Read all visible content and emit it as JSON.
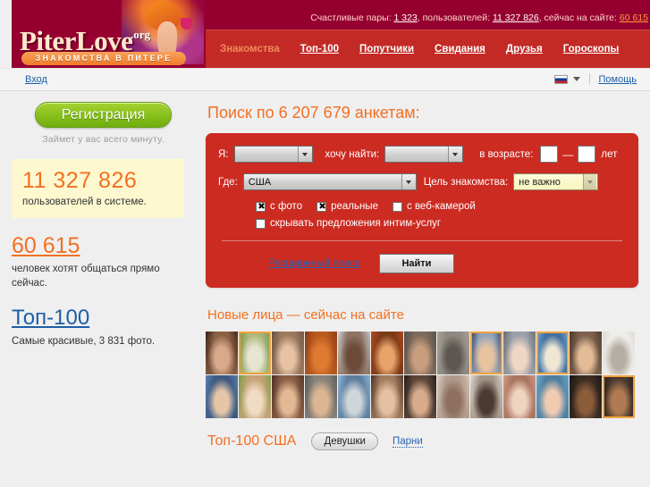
{
  "header": {
    "logo": {
      "word": "PiterLove",
      "org": ".org",
      "tagline": "ЗНАКОМСТВА В ПИТЕРЕ"
    },
    "stats": {
      "couples_label": "Счастливые пары:",
      "couples_value": "1 323",
      "users_label": ", пользователей:",
      "users_value": "11 327 826",
      "online_label": ", сейчас на сайте:",
      "online_value": "60 615"
    },
    "nav": [
      {
        "label": "Знакомства",
        "active": true
      },
      {
        "label": "Топ-100",
        "active": false
      },
      {
        "label": "Попутчики",
        "active": false
      },
      {
        "label": "Свидания",
        "active": false
      },
      {
        "label": "Друзья",
        "active": false
      },
      {
        "label": "Гороскопы",
        "active": false
      }
    ]
  },
  "loginbar": {
    "login_label": "Вход",
    "flag_icon": "russian-flag-icon",
    "caret_icon": "chevron-down-icon",
    "help_label": "Помощь"
  },
  "sidebar": {
    "register_button": "Регистрация",
    "register_sub": "Займет у вас всего минуту.",
    "users_number": "11 327 826",
    "users_caption": "пользователей в системе.",
    "online_number": "60 615",
    "online_caption": "человек хотят общаться прямо сейчас.",
    "top100_link": "Топ-100",
    "top100_caption": "Самые красивые, 3 831 фото."
  },
  "search": {
    "title": "Поиск по 6 207 679 анкетам:",
    "label_me": "Я:",
    "value_me": "",
    "label_find": "хочу найти:",
    "value_find": "",
    "label_age": "в возрасте:",
    "age_from": "",
    "age_to": "",
    "age_dash": "—",
    "age_unit": "лет",
    "label_where": "Где:",
    "value_where": "США",
    "label_goal": "Цель знакомства:",
    "value_goal": "не важно",
    "checkboxes": [
      {
        "label": "с фото",
        "checked": true
      },
      {
        "label": "реальные",
        "checked": true
      },
      {
        "label": "с веб-камерой",
        "checked": false
      },
      {
        "label": "скрывать предложения интим-услуг",
        "checked": false
      }
    ],
    "advanced_link": "Расширеный поиск",
    "find_button": "Найти"
  },
  "newfaces": {
    "title": "Новые лица — сейчас на сайте",
    "photos": [
      {
        "name": "photo-1",
        "online": false,
        "c1": "#3b2318",
        "c2": "#d8a98a",
        "c3": "#8a5f44"
      },
      {
        "name": "photo-2",
        "online": true,
        "c1": "#6f8f4a",
        "c2": "#e8e4d2",
        "c3": "#aab87a"
      },
      {
        "name": "photo-3",
        "online": false,
        "c1": "#6b5244",
        "c2": "#e7c2a4",
        "c3": "#9d7a5e"
      },
      {
        "name": "photo-4",
        "online": false,
        "c1": "#8a3a12",
        "c2": "#e07a32",
        "c3": "#b85a1e"
      },
      {
        "name": "photo-5",
        "online": false,
        "c1": "#c9cdd2",
        "c2": "#6b4a3a",
        "c3": "#8e7463"
      },
      {
        "name": "photo-6",
        "online": false,
        "c1": "#b5491c",
        "c2": "#e9a26a",
        "c3": "#7a3a18"
      },
      {
        "name": "photo-7",
        "online": false,
        "c1": "#53504c",
        "c2": "#c99d7e",
        "c3": "#7d6a5a"
      },
      {
        "name": "photo-8",
        "online": false,
        "c1": "#a9a399",
        "c2": "#5c5750",
        "c3": "#8d8880"
      },
      {
        "name": "photo-9",
        "online": true,
        "c1": "#2b3a55",
        "c2": "#e8c3a0",
        "c3": "#8fa3bb"
      },
      {
        "name": "photo-10",
        "online": false,
        "c1": "#6b6f76",
        "c2": "#f0d7c5",
        "c3": "#9aa0a8"
      },
      {
        "name": "photo-11",
        "online": true,
        "c1": "#6fa8d8",
        "c2": "#efe6d4",
        "c3": "#3e6f9e"
      },
      {
        "name": "photo-12",
        "online": false,
        "c1": "#4a3a30",
        "c2": "#e3bc97",
        "c3": "#7b5f4b"
      },
      {
        "name": "photo-13",
        "online": false,
        "c1": "#dedad4",
        "c2": "#b6aea4",
        "c3": "#efeeea"
      },
      {
        "name": "photo-14",
        "online": false,
        "c1": "#5a7fae",
        "c2": "#e6c6a8",
        "c3": "#3c5a80"
      },
      {
        "name": "photo-15",
        "online": false,
        "c1": "#7c9d46",
        "c2": "#f0dcc2",
        "c3": "#c6a277"
      },
      {
        "name": "photo-16",
        "online": false,
        "c1": "#4b2f26",
        "c2": "#e3b894",
        "c3": "#8a5d44"
      },
      {
        "name": "photo-17",
        "online": false,
        "c1": "#5b5a56",
        "c2": "#dcb692",
        "c3": "#86817a"
      },
      {
        "name": "photo-18",
        "online": false,
        "c1": "#8fb6d8",
        "c2": "#cfd6da",
        "c3": "#5d7e9c"
      },
      {
        "name": "photo-19",
        "online": false,
        "c1": "#4a3326",
        "c2": "#e6c0a2",
        "c3": "#a07b5e"
      },
      {
        "name": "photo-20",
        "online": false,
        "c1": "#241c18",
        "c2": "#d8ab8c",
        "c3": "#5c463a"
      },
      {
        "name": "photo-21",
        "online": false,
        "c1": "#d7c8bc",
        "c2": "#8f7060",
        "c3": "#b09a8a"
      },
      {
        "name": "photo-22",
        "online": false,
        "c1": "#dcd6cc",
        "c2": "#4a3a32",
        "c3": "#a39488"
      },
      {
        "name": "photo-23",
        "online": false,
        "c1": "#cf9b86",
        "c2": "#efd4c0",
        "c3": "#a87460"
      },
      {
        "name": "photo-24",
        "online": false,
        "c1": "#6fa6c8",
        "c2": "#f0cbb2",
        "c3": "#4e7e9e"
      },
      {
        "name": "photo-25",
        "online": false,
        "c1": "#1a1714",
        "c2": "#8a5c3a",
        "c3": "#3a2c22"
      },
      {
        "name": "photo-26",
        "online": true,
        "c1": "#231d1a",
        "c2": "#b07a52",
        "c3": "#4a3a30"
      }
    ]
  },
  "top100": {
    "title": "Топ-100 США",
    "tab_girls": "Девушки",
    "tab_boys": "Парни"
  }
}
